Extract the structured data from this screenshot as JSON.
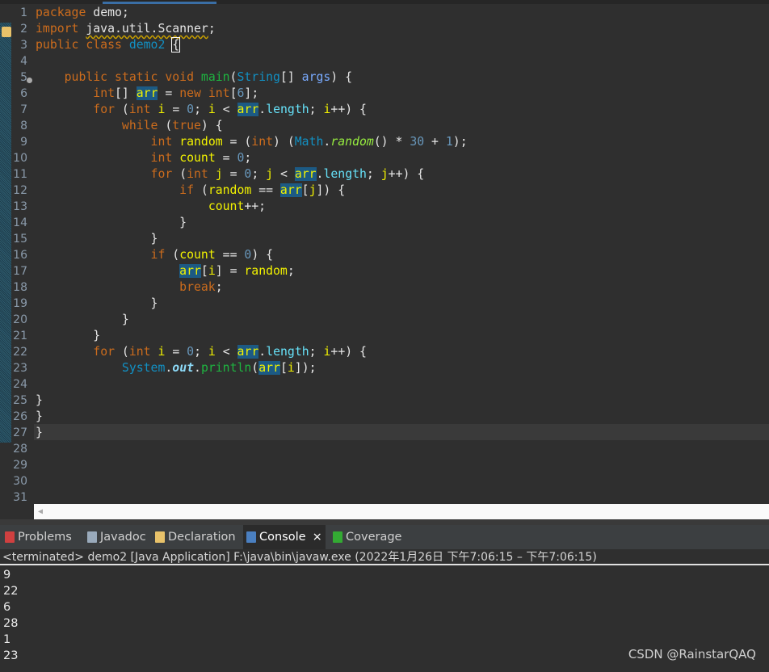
{
  "code": {
    "lines": [
      [
        [
          "k",
          "package "
        ],
        [
          "p",
          "demo;"
        ]
      ],
      [
        [
          "k",
          "import "
        ],
        [
          "w",
          "java.util.Scanner"
        ],
        [
          "p",
          ";"
        ]
      ],
      [
        [
          "k",
          "public class "
        ],
        [
          "t",
          "demo2 "
        ],
        [
          "b",
          "{"
        ]
      ],
      [],
      [
        [
          "p",
          "    "
        ],
        [
          "k",
          "public static void "
        ],
        [
          "m",
          "main"
        ],
        [
          "p",
          "("
        ],
        [
          "t",
          "String"
        ],
        [
          "p",
          "[] "
        ],
        [
          "a",
          "args"
        ],
        [
          "p",
          ") {"
        ]
      ],
      [
        [
          "p",
          "        "
        ],
        [
          "k",
          "int"
        ],
        [
          "p",
          "[] "
        ],
        [
          "h",
          "arr"
        ],
        [
          "p",
          " = "
        ],
        [
          "k",
          "new int"
        ],
        [
          "p",
          "["
        ],
        [
          "n",
          "6"
        ],
        [
          "p",
          "];"
        ]
      ],
      [
        [
          "p",
          "        "
        ],
        [
          "k",
          "for "
        ],
        [
          "p",
          "("
        ],
        [
          "k",
          "int "
        ],
        [
          "v",
          "i"
        ],
        [
          "p",
          " = "
        ],
        [
          "n",
          "0"
        ],
        [
          "p",
          "; "
        ],
        [
          "v",
          "i"
        ],
        [
          "p",
          " < "
        ],
        [
          "h",
          "arr"
        ],
        [
          "p",
          "."
        ],
        [
          "f",
          "length"
        ],
        [
          "p",
          "; "
        ],
        [
          "v",
          "i"
        ],
        [
          "p",
          "++) {"
        ]
      ],
      [
        [
          "p",
          "            "
        ],
        [
          "k",
          "while "
        ],
        [
          "p",
          "("
        ],
        [
          "k",
          "true"
        ],
        [
          "p",
          ") {"
        ]
      ],
      [
        [
          "p",
          "                "
        ],
        [
          "k",
          "int "
        ],
        [
          "v",
          "random"
        ],
        [
          "p",
          " = ("
        ],
        [
          "k",
          "int"
        ],
        [
          "p",
          ") ("
        ],
        [
          "t",
          "Math"
        ],
        [
          "p",
          "."
        ],
        [
          "s",
          "random"
        ],
        [
          "p",
          "() * "
        ],
        [
          "n",
          "30"
        ],
        [
          "p",
          " + "
        ],
        [
          "n",
          "1"
        ],
        [
          "p",
          ");"
        ]
      ],
      [
        [
          "p",
          "                "
        ],
        [
          "k",
          "int "
        ],
        [
          "v",
          "count"
        ],
        [
          "p",
          " = "
        ],
        [
          "n",
          "0"
        ],
        [
          "p",
          ";"
        ]
      ],
      [
        [
          "p",
          "                "
        ],
        [
          "k",
          "for "
        ],
        [
          "p",
          "("
        ],
        [
          "k",
          "int "
        ],
        [
          "v",
          "j"
        ],
        [
          "p",
          " = "
        ],
        [
          "n",
          "0"
        ],
        [
          "p",
          "; "
        ],
        [
          "v",
          "j"
        ],
        [
          "p",
          " < "
        ],
        [
          "h",
          "arr"
        ],
        [
          "p",
          "."
        ],
        [
          "f",
          "length"
        ],
        [
          "p",
          "; "
        ],
        [
          "v",
          "j"
        ],
        [
          "p",
          "++) {"
        ]
      ],
      [
        [
          "p",
          "                    "
        ],
        [
          "k",
          "if "
        ],
        [
          "p",
          "("
        ],
        [
          "v",
          "random"
        ],
        [
          "p",
          " == "
        ],
        [
          "h",
          "arr"
        ],
        [
          "p",
          "["
        ],
        [
          "v",
          "j"
        ],
        [
          "p",
          "]) {"
        ]
      ],
      [
        [
          "p",
          "                        "
        ],
        [
          "v",
          "count"
        ],
        [
          "p",
          "++;"
        ]
      ],
      [
        [
          "p",
          "                    }"
        ]
      ],
      [
        [
          "p",
          "                }"
        ]
      ],
      [
        [
          "p",
          "                "
        ],
        [
          "k",
          "if "
        ],
        [
          "p",
          "("
        ],
        [
          "v",
          "count"
        ],
        [
          "p",
          " == "
        ],
        [
          "n",
          "0"
        ],
        [
          "p",
          ") {"
        ]
      ],
      [
        [
          "p",
          "                    "
        ],
        [
          "h",
          "arr"
        ],
        [
          "p",
          "["
        ],
        [
          "v",
          "i"
        ],
        [
          "p",
          "] = "
        ],
        [
          "v",
          "random"
        ],
        [
          "p",
          ";"
        ]
      ],
      [
        [
          "p",
          "                    "
        ],
        [
          "k",
          "break"
        ],
        [
          "p",
          ";"
        ]
      ],
      [
        [
          "p",
          "                }"
        ]
      ],
      [
        [
          "p",
          "            }"
        ]
      ],
      [
        [
          "p",
          "        }"
        ]
      ],
      [
        [
          "p",
          "        "
        ],
        [
          "k",
          "for "
        ],
        [
          "p",
          "("
        ],
        [
          "k",
          "int "
        ],
        [
          "v",
          "i"
        ],
        [
          "p",
          " = "
        ],
        [
          "n",
          "0"
        ],
        [
          "p",
          "; "
        ],
        [
          "v",
          "i"
        ],
        [
          "p",
          " < "
        ],
        [
          "h",
          "arr"
        ],
        [
          "p",
          "."
        ],
        [
          "f",
          "length"
        ],
        [
          "p",
          "; "
        ],
        [
          "v",
          "i"
        ],
        [
          "p",
          "++) {"
        ]
      ],
      [
        [
          "p",
          "            "
        ],
        [
          "t",
          "System"
        ],
        [
          "p",
          "."
        ],
        [
          "o",
          "out"
        ],
        [
          "p",
          "."
        ],
        [
          "m",
          "println"
        ],
        [
          "p",
          "("
        ],
        [
          "h",
          "arr"
        ],
        [
          "p",
          "["
        ],
        [
          "v",
          "i"
        ],
        [
          "p",
          "]);"
        ]
      ],
      [],
      [
        [
          "p",
          "}"
        ]
      ],
      [
        [
          "p",
          "}"
        ]
      ],
      [
        [
          "p",
          "}"
        ]
      ],
      [],
      [],
      [],
      []
    ]
  },
  "tabs": [
    {
      "label": "Problems",
      "icon": "problems-icon",
      "color": "#d04040"
    },
    {
      "label": "Javadoc",
      "icon": "javadoc-at-icon",
      "color": "#9ab"
    },
    {
      "label": "Declaration",
      "icon": "declaration-icon",
      "color": "#e8c26a"
    },
    {
      "label": "Console",
      "icon": "console-icon",
      "color": "#4a7fc0",
      "active": true,
      "close": "×"
    },
    {
      "label": "Coverage",
      "icon": "coverage-icon",
      "color": "#3a3"
    }
  ],
  "console": {
    "status": "<terminated> demo2 [Java Application] F:\\java\\bin\\javaw.exe  (2022年1月26日 下午7:06:15 – 下午7:06:15)",
    "output": [
      "9",
      "22",
      "6",
      "28",
      "1",
      "23"
    ]
  },
  "watermark": "CSDN @RainstarQAQ"
}
